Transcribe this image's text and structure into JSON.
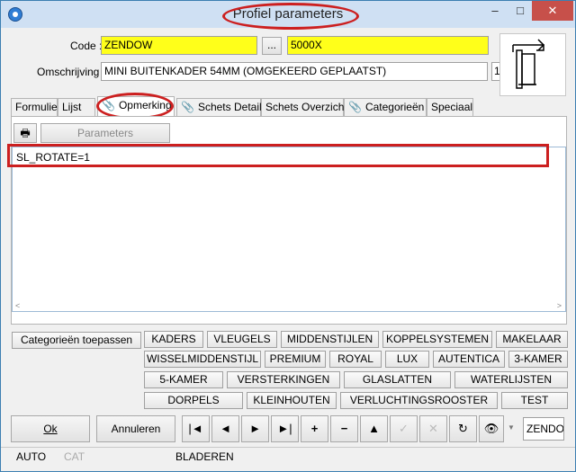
{
  "window": {
    "title": "Profiel parameters",
    "minimize": "–",
    "restore": "□",
    "close": "✕"
  },
  "form": {
    "code_label": "Code :",
    "code_value": "ZENDOW",
    "lookup_button": "...",
    "code2_value": "5000X",
    "omschrijving_label": "Omschrijving :",
    "omschrijving_value": "MINI BUITENKADER 54MM (OMGEKEERD GEPLAATST)",
    "counter_value": "1"
  },
  "tabs": [
    {
      "label": "Formulier",
      "clip": false
    },
    {
      "label": "Lijst",
      "clip": false
    },
    {
      "label": "Opmerking",
      "clip": true,
      "active": true
    },
    {
      "label": "Schets Detail",
      "clip": true
    },
    {
      "label": "Schets Overzicht",
      "clip": false
    },
    {
      "label": "Categorieën",
      "clip": true
    },
    {
      "label": "Speciaal",
      "clip": false
    }
  ],
  "toolbar": {
    "print_icon": "printer-icon",
    "parameters_label": "Parameters"
  },
  "memo": {
    "text": "SL_ROTATE=1"
  },
  "categories": {
    "apply_label": "Categorieën toepassen",
    "rows": [
      [
        "KADERS",
        "VLEUGELS",
        "MIDDENSTIJLEN",
        "KOPPELSYSTEMEN",
        "MAKELAAR"
      ],
      [
        "WISSELMIDDENSTIJL",
        "PREMIUM",
        "ROYAL",
        "LUX",
        "AUTENTICA",
        "3-KAMER"
      ],
      [
        "5-KAMER",
        "VERSTERKINGEN",
        "GLASLATTEN",
        "WATERLIJSTEN"
      ],
      [
        "DORPELS",
        "KLEINHOUTEN",
        "VERLUCHTINGSROOSTER",
        "TEST"
      ]
    ]
  },
  "footer": {
    "ok_label": "Ok",
    "cancel_label": "Annuleren",
    "nav_buttons": [
      {
        "icon": "first-icon",
        "glyph": "|◄"
      },
      {
        "icon": "prev-icon",
        "glyph": "◄"
      },
      {
        "icon": "next-icon",
        "glyph": "►"
      },
      {
        "icon": "last-icon",
        "glyph": "►|"
      },
      {
        "icon": "add-icon",
        "glyph": "+"
      },
      {
        "icon": "delete-icon",
        "glyph": "−"
      },
      {
        "icon": "edit-icon",
        "glyph": "▲"
      },
      {
        "icon": "confirm-icon",
        "glyph": "✓"
      },
      {
        "icon": "cancel-icon",
        "glyph": "✕"
      },
      {
        "icon": "refresh-icon",
        "glyph": "↻"
      },
      {
        "icon": "binoculars-icon",
        "glyph": "👁"
      }
    ],
    "search_value": "ZENDO"
  },
  "status": {
    "mode": "AUTO",
    "cat": "CAT",
    "state": "BLADEREN"
  },
  "colors": {
    "highlight": "#cc1f1f",
    "field_yellow": "#ffff1a",
    "title_bg": "#cfe0f3"
  }
}
